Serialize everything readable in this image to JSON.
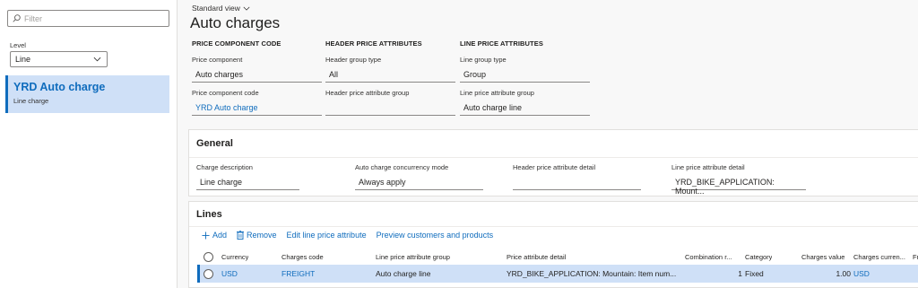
{
  "left_pane": {
    "filter_placeholder": "Filter",
    "level_label": "Level",
    "level_value": "Line",
    "item": {
      "title": "YRD Auto charge",
      "subtitle": "Line charge"
    }
  },
  "header": {
    "view_name": "Standard view",
    "title": "Auto charges"
  },
  "sections": {
    "price_component": {
      "heading": "PRICE COMPONENT CODE",
      "component_label": "Price component",
      "component_value": "Auto charges",
      "code_label": "Price component code",
      "code_value": "YRD Auto charge"
    },
    "header_attrs": {
      "heading": "HEADER PRICE ATTRIBUTES",
      "group_type_label": "Header group type",
      "group_type_value": "All",
      "attr_group_label": "Header price attribute group",
      "attr_group_value": ""
    },
    "line_attrs": {
      "heading": "LINE PRICE ATTRIBUTES",
      "group_type_label": "Line group type",
      "group_type_value": "Group",
      "attr_group_label": "Line price attribute group",
      "attr_group_value": "Auto charge line"
    }
  },
  "general": {
    "heading": "General",
    "charge_desc_label": "Charge description",
    "charge_desc_value": "Line charge",
    "concurrency_label": "Auto charge concurrency mode",
    "concurrency_value": "Always apply",
    "header_detail_label": "Header price attribute detail",
    "header_detail_value": "",
    "line_detail_label": "Line price attribute detail",
    "line_detail_value": "YRD_BIKE_APPLICATION: Mount..."
  },
  "lines": {
    "heading": "Lines",
    "toolbar": {
      "add": "Add",
      "remove": "Remove",
      "edit": "Edit line price attribute",
      "preview": "Preview customers and products"
    },
    "columns": [
      "Currency",
      "Charges code",
      "Line price attribute group",
      "Price attribute detail",
      "Combination r...",
      "Category",
      "Charges value",
      "Charges curren...",
      "Fr"
    ],
    "rows": [
      [
        "USD",
        "FREIGHT",
        "Auto charge line",
        "YRD_BIKE_APPLICATION: Mountain: Item num...",
        "1",
        "Fixed",
        "1.00",
        "USD",
        ""
      ]
    ]
  },
  "colors": {
    "accent": "#0f6cbd",
    "selected_bg": "#cfe0f7"
  }
}
